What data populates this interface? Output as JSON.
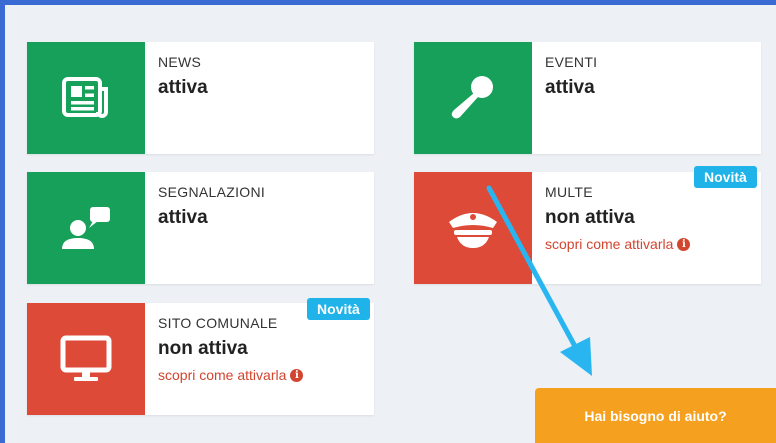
{
  "services": [
    {
      "name": "NEWS",
      "status": "attiva",
      "tile_color": "#16a05a",
      "icon": "newspaper-icon"
    },
    {
      "name": "EVENTI",
      "status": "attiva",
      "tile_color": "#16a05a",
      "icon": "microphone-icon"
    },
    {
      "name": "SEGNALAZIONI",
      "status": "attiva",
      "tile_color": "#16a05a",
      "icon": "user-speech-icon"
    },
    {
      "name": "MULTE",
      "status": "non attiva",
      "tile_color": "#dd4a38",
      "icon": "police-cap-icon",
      "link": "scopri come attivarla",
      "badge": "Novità"
    },
    {
      "name": "SITO COMUNALE",
      "status": "non attiva",
      "tile_color": "#dd4a38",
      "icon": "monitor-icon",
      "link": "scopri come attivarla",
      "badge": "Novità"
    }
  ],
  "help_button": {
    "label": "Hai bisogno di aiuto?",
    "color": "#f5a11f"
  },
  "colors": {
    "active": "#16a05a",
    "inactive": "#dd4a38",
    "badge": "#1fb3ea",
    "link": "#d2452f"
  }
}
